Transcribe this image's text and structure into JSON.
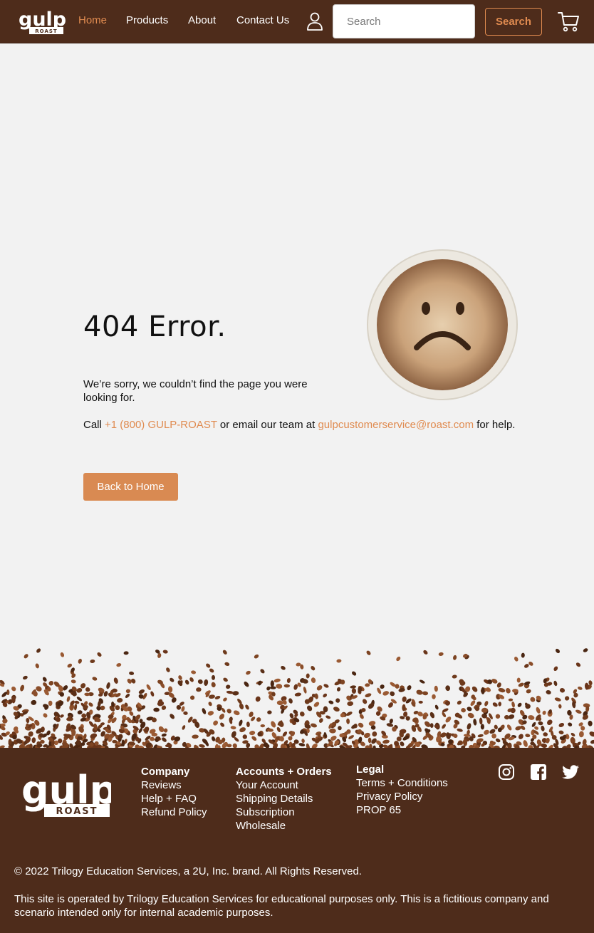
{
  "header": {
    "logo": {
      "word": "gulp",
      "sub": "ROAST"
    },
    "nav": [
      {
        "label": "Home",
        "active": true
      },
      {
        "label": "Products",
        "active": false
      },
      {
        "label": "About",
        "active": false
      },
      {
        "label": "Contact Us",
        "active": false
      }
    ],
    "search": {
      "placeholder": "Search",
      "button_label": "Search"
    },
    "icons": {
      "account": "user-icon",
      "cart": "cart-icon"
    }
  },
  "main": {
    "title": "404 Error.",
    "message": "We’re sorry, we couldn’t find the page you were looking for.",
    "help": {
      "prefix": "Call ",
      "phone": "+1 (800) GULP-ROAST",
      "middle": " or email our team at ",
      "email": "gulpcustomerservice@roast.com",
      "suffix": " for help."
    },
    "back_button": "Back to Home"
  },
  "footer": {
    "logo": {
      "word": "gulp",
      "sub": "ROAST"
    },
    "company": {
      "heading": "Company",
      "items": [
        "Reviews",
        "Help + FAQ",
        "Refund Policy"
      ]
    },
    "accounts": {
      "heading": "Accounts + Orders",
      "items": [
        "Your Account",
        "Shipping Details",
        "Subscription",
        "Wholesale"
      ]
    },
    "legal": {
      "heading": "Legal",
      "items": [
        "Terms + Conditions",
        "Privacy Policy",
        "PROP 65"
      ]
    },
    "social": [
      "instagram-icon",
      "facebook-icon",
      "twitter-icon"
    ],
    "copyright": "© 2022 Trilogy Education Services, a 2U, Inc. brand. All Rights Reserved.",
    "disclaimer": "This site is operated by Trilogy Education Services for educational purposes only. This is a fictitious company and scenario intended only for internal academic purposes."
  },
  "colors": {
    "brand_brown": "#4e2c1b",
    "accent": "#e08b50",
    "button": "#d98a52",
    "page_bg": "#f2f2f2"
  }
}
